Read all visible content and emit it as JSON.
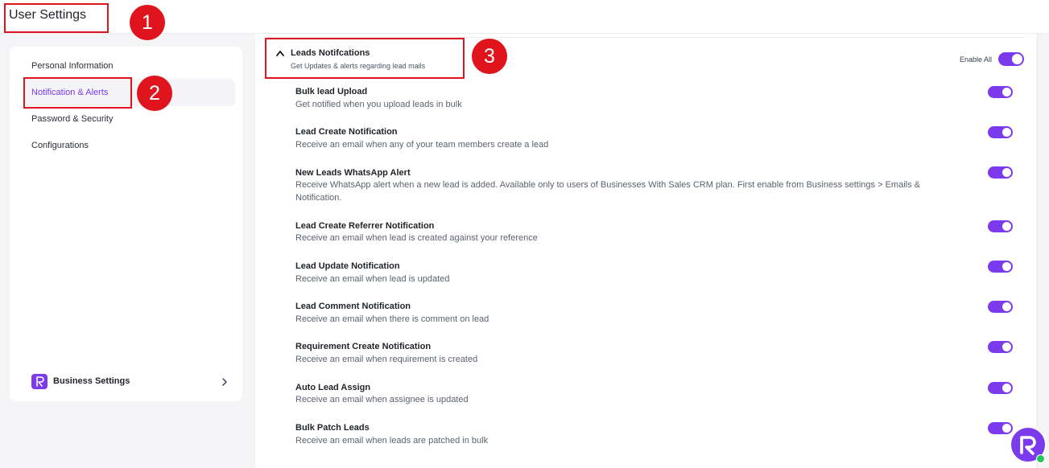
{
  "header": {
    "title": "User Settings"
  },
  "annotations": [
    "1",
    "2",
    "3"
  ],
  "sidebar": {
    "items": [
      {
        "label": "Personal Information"
      },
      {
        "label": "Notification & Alerts",
        "active": true
      },
      {
        "label": "Password & Security"
      },
      {
        "label": "Configurations"
      }
    ],
    "business": {
      "logo_text": "Refrens",
      "label": "Business Settings"
    }
  },
  "section": {
    "title": "Leads Notifcations",
    "subtitle": "Get Updates & alerts regarding lead mails",
    "enable_all_label": "Enable All",
    "enable_all_on": true
  },
  "notifications": [
    {
      "title": "Bulk lead Upload",
      "desc": "Get notified when you upload leads in bulk",
      "on": true
    },
    {
      "title": "Lead Create Notification",
      "desc": "Receive an email when any of your team members create a lead",
      "on": true
    },
    {
      "title": "New Leads WhatsApp Alert",
      "desc": "Receive WhatsApp alert when a new lead is added. Available only to users of Businesses With Sales CRM plan. First enable from Business settings > Emails & Notification.",
      "on": true
    },
    {
      "title": "Lead Create Referrer Notification",
      "desc": "Receive an email when lead is created against your reference",
      "on": true
    },
    {
      "title": "Lead Update Notification",
      "desc": "Receive an email when lead is updated",
      "on": true
    },
    {
      "title": "Lead Comment Notification",
      "desc": "Receive an email when there is comment on lead",
      "on": true
    },
    {
      "title": "Requirement Create Notification",
      "desc": "Receive an email when requirement is created",
      "on": true
    },
    {
      "title": "Auto Lead Assign",
      "desc": "Receive an email when assignee is updated",
      "on": true
    },
    {
      "title": "Bulk Patch Leads",
      "desc": "Receive an email when leads are patched in bulk",
      "on": true
    }
  ],
  "colors": {
    "accent": "#7c3aed",
    "annotation": "#e0141c",
    "online": "#22c55e"
  }
}
